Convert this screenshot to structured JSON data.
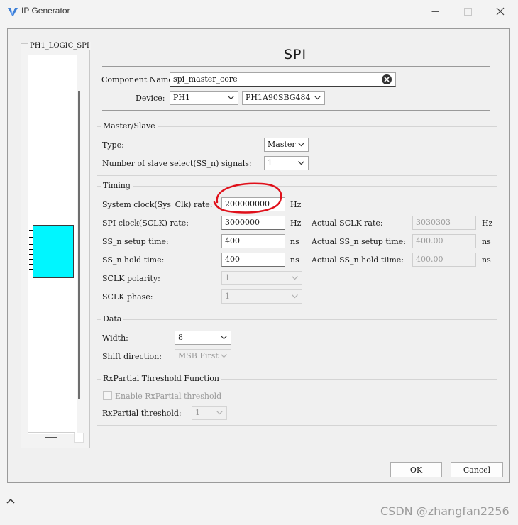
{
  "window": {
    "title": "IP Generator",
    "minimize_icon": "minimize-icon",
    "maximize_icon": "maximize-icon",
    "close_icon": "close-icon"
  },
  "preview": {
    "title": "PH1_LOGIC_SPI"
  },
  "header": {
    "title": "SPI",
    "component_name_label": "Component Name:",
    "component_name_value": "spi_master_core",
    "device_label": "Device:",
    "device_family": "PH1",
    "device_part": "PH1A90SBG484"
  },
  "master_slave": {
    "title": "Master/Slave",
    "type_label": "Type:",
    "type_value": "Master",
    "slaves_label": "Number of slave select(SS_n) signals:",
    "slaves_value": "1"
  },
  "timing": {
    "title": "Timing",
    "sys_clk_label": "System clock(Sys_Clk) rate:",
    "sys_clk_value": "200000000",
    "sys_clk_unit": "Hz",
    "sclk_label": "SPI clock(SCLK) rate:",
    "sclk_value": "3000000",
    "sclk_unit": "Hz",
    "actual_sclk_label": "Actual SCLK rate:",
    "actual_sclk_value": "3030303",
    "actual_sclk_unit": "Hz",
    "setup_label": "SS_n setup time:",
    "setup_value": "400",
    "setup_unit": "ns",
    "actual_setup_label": "Actual SS_n setup time:",
    "actual_setup_value": "400.00",
    "actual_setup_unit": "ns",
    "hold_label": "SS_n hold time:",
    "hold_value": "400",
    "hold_unit": "ns",
    "actual_hold_label": "Actual SS_n hold tiime:",
    "actual_hold_value": "400.00",
    "actual_hold_unit": "ns",
    "polarity_label": "SCLK polarity:",
    "polarity_value": "1",
    "phase_label": "SCLK phase:",
    "phase_value": "1"
  },
  "data": {
    "title": "Data",
    "width_label": "Width:",
    "width_value": "8",
    "shift_label": "Shift direction:",
    "shift_value": "MSB First"
  },
  "rx_partial": {
    "title": "RxPartial Threshold Function",
    "enable_label": "Enable RxPartial threshold",
    "threshold_label": "RxPartial threshold:",
    "threshold_value": "1"
  },
  "buttons": {
    "ok": "OK",
    "cancel": "Cancel"
  },
  "watermark": "CSDN @zhangfan2256",
  "colors": {
    "ip_block": "#00f6ff",
    "annotation": "#e0101a"
  }
}
